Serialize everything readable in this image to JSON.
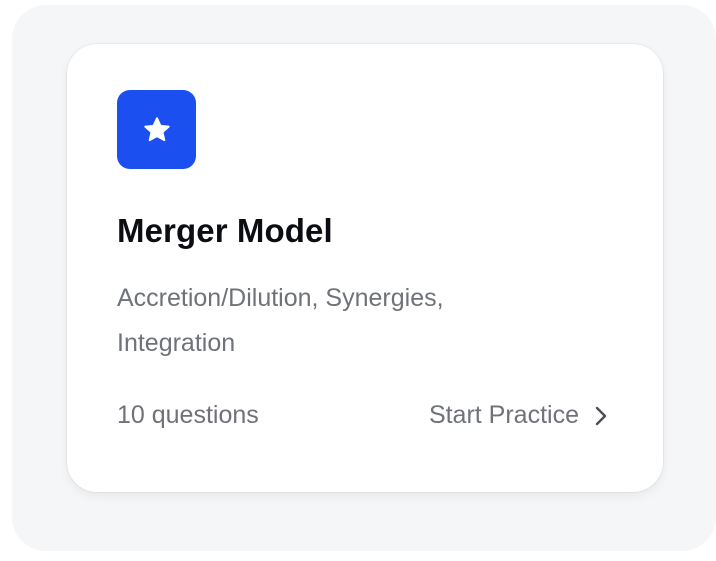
{
  "card": {
    "title": "Merger Model",
    "description": "Accretion/Dilution, Synergies, Integration",
    "question_count": "10 questions",
    "action_label": "Start Practice",
    "icon": "star-icon",
    "accent_color": "#1b4ff0"
  }
}
